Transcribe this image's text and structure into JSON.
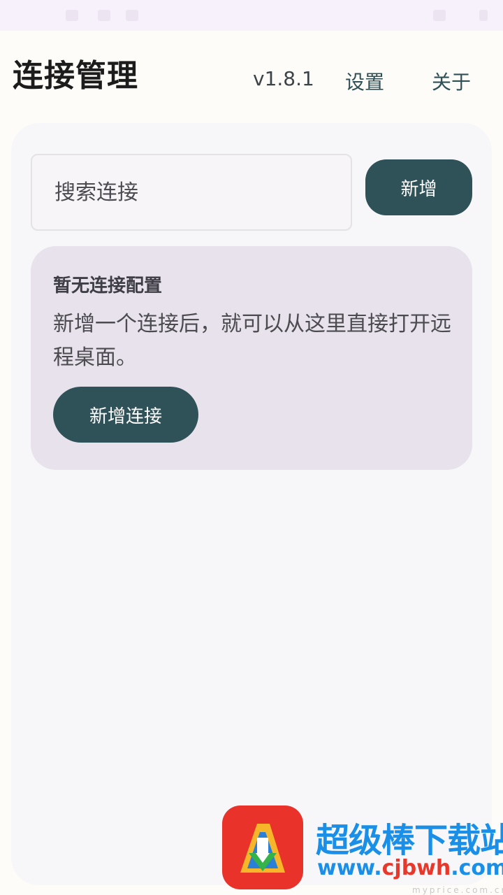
{
  "header": {
    "title": "连接管理",
    "version": "v1.8.1",
    "settings_label": "设置",
    "about_label": "关于"
  },
  "search": {
    "placeholder": "搜索连接"
  },
  "toolbar": {
    "add_label": "新增"
  },
  "empty_state": {
    "title": "暂无连接配置",
    "description": "新增一个连接后，就可以从这里直接打开远程桌面。",
    "add_connection_label": "新增连接"
  },
  "watermark": {
    "name": "超级棒下载站",
    "url_prefix": "www.",
    "url_accent": "cjbwh",
    "url_suffix": ".com",
    "small_text": "myprice.com.cn"
  },
  "colors": {
    "primary": "#2f5158",
    "accent_link": "#2f5056",
    "card_bg": "#f7f6f9",
    "empty_card_bg": "#e7e2eb"
  }
}
